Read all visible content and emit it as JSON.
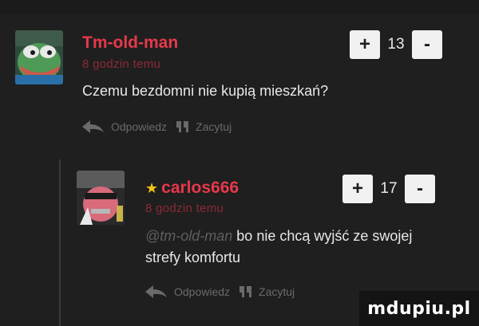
{
  "comments": [
    {
      "author": "Tm-old-man",
      "time": "8 godzin temu",
      "text": "Czemu bezdomni nie kupią mieszkań?",
      "vote_plus": "+",
      "vote_count": "13",
      "vote_minus": "-",
      "reply_label": "Odpowiedz",
      "quote_label": "Zacytuj"
    },
    {
      "author": "carlos666",
      "time": "8 godzin temu",
      "mention": "@tm-old-man",
      "text_line1": " bo nie chcą wyjść ze swojej",
      "text_line2": "strefy komfortu",
      "vote_plus": "+",
      "vote_count": "17",
      "vote_minus": "-",
      "reply_label": "Odpowiedz",
      "quote_label": "Zacytuj"
    }
  ],
  "watermark": "mdupiu.pl",
  "icons": {
    "star": "star-icon",
    "reply": "reply-arrow-icon",
    "quote": "quote-icon"
  },
  "colors": {
    "background": "#1f1f1f",
    "author": "#e6394a",
    "time": "#8c2a33",
    "star": "#f0c21b"
  }
}
